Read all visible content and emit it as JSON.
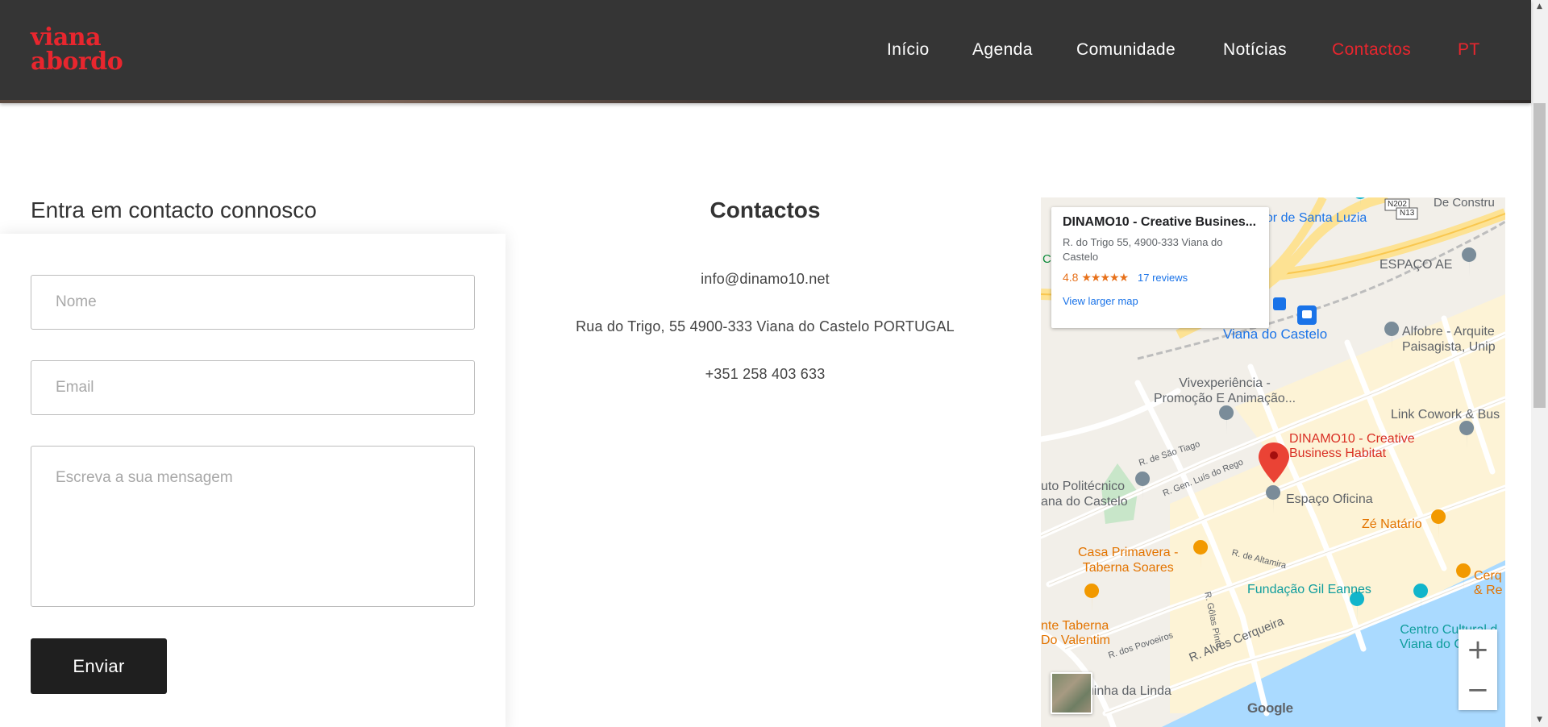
{
  "header": {
    "logo_line1": "viana",
    "logo_line2": "abordo",
    "nav": [
      {
        "label": "Início"
      },
      {
        "label": "Agenda"
      },
      {
        "label": "Comunidade"
      },
      {
        "label": "Notícias"
      },
      {
        "label": "Contactos",
        "active": true
      },
      {
        "label": "PT",
        "active": true
      }
    ],
    "accent_color": "#e8262e",
    "background_color": "#353535"
  },
  "form": {
    "title": "Entra em contacto connosco",
    "name_placeholder": "Nome",
    "email_placeholder": "Email",
    "message_placeholder": "Escreva a sua mensagem",
    "submit_label": "Enviar"
  },
  "contacts": {
    "title": "Contactos",
    "email": "info@dinamo10.net",
    "address": "Rua do Trigo, 55 4900-333 Viana do Castelo PORTUGAL",
    "phone": "+351 258 403 633"
  },
  "map": {
    "card": {
      "title": "DINAMO10 - Creative Busines...",
      "address": "R. do Trigo 55, 4900-333 Viana do Castelo",
      "rating": "4.8",
      "stars": "★★★★★",
      "reviews": "17 reviews",
      "link": "View larger map"
    },
    "labels": {
      "santa_luzia": "dor de Santa Luzia",
      "de_constru": "De Constru",
      "n202": "N202",
      "n13": "N13",
      "espaco_ae": "ESPAÇO AE",
      "viana": "Viana do Castelo",
      "alfobre1": "Alfobre - Arquite",
      "alfobre2": "Paisagista, Unip",
      "vivex1": "Vivexperiência -",
      "vivex2": "Promoção E Animação...",
      "link_cowork": "Link Cowork & Bus",
      "dinamo1": "DINAMO10 - Creative",
      "dinamo2": "Business Habitat",
      "sao_tiago": "R. de São Tiago",
      "luis_rego": "R. Gen. Luís do Rego",
      "politecnico1": "uto Politécnico",
      "politecnico2": "ana do Castelo",
      "espaco_oficina": "Espaço Oficina",
      "ze_natario": "Zé Natário",
      "casa_primavera1": "Casa Primavera -",
      "casa_primavera2": "Taberna Soares",
      "altamira": "R. de Altamira",
      "cerq1": "Cerq",
      "cerq2": "& Re",
      "fundacao": "Fundação Gil Eannes",
      "golas_pinto": "R. Gôlas Pinto",
      "taberna_valentim1": "nte Taberna",
      "taberna_valentim2": "Do Valentim",
      "povoeiros": "R. dos Povoeiros",
      "alves_cerqueira": "R. Alves Cerqueira",
      "centro_cultural1": "Centro Cultural d",
      "centro_cultural2": "Viana do Castelo",
      "esquinha": "squinha da Linda",
      "c_label": "C"
    },
    "zoom_in": "+",
    "zoom_out": "−",
    "google": "Google"
  },
  "scrollbar": {
    "up": "▲",
    "down": "▼"
  }
}
